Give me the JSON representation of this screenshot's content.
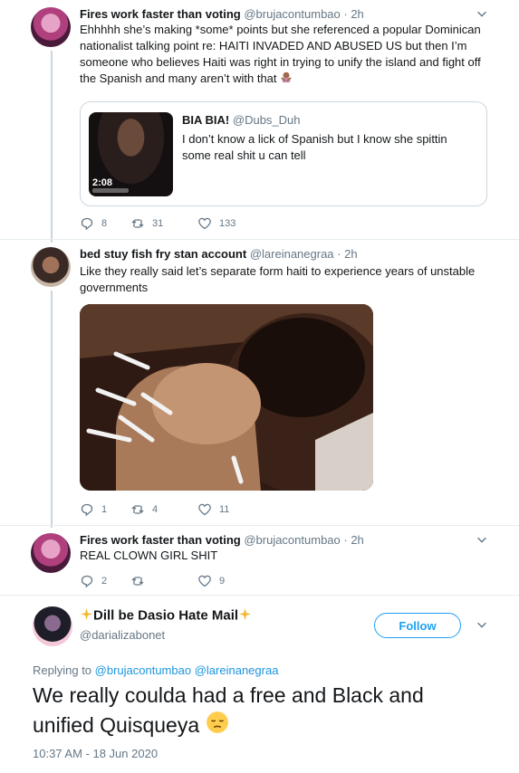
{
  "tweets": [
    {
      "name": "Fires work faster than voting",
      "handle": "@brujacontumbao",
      "sep": " · ",
      "time": "2h",
      "text": "Ehhhhh she’s making *some* points but she referenced a popular Dominican nationalist talking point re: HAITI INVADED AND ABUSED US but then I’m someone who believes Haiti was right in trying to unify the island and fight off the Spanish and many aren’t with that",
      "emoji": "person-gesturing-no",
      "quote": {
        "name": "BIA BIA!",
        "handle": "@Dubs_Duh",
        "text": "I don’t know a lick of Spanish but I know she spittin some real shit u can tell",
        "duration": "2:08"
      },
      "replies": "8",
      "retweets": "31",
      "likes": "133"
    },
    {
      "name": "bed stuy fish fry stan account",
      "handle": "@lareinanegraa",
      "sep": " · ",
      "time": "2h",
      "text": "Like they really said let’s separate form haiti to experience years of unstable governments",
      "replies": "1",
      "retweets": "4",
      "likes": "11"
    },
    {
      "name": "Fires work faster than voting",
      "handle": "@brujacontumbao",
      "sep": " · ",
      "time": "2h",
      "text": "REAL CLOWN GIRL SHIT",
      "replies": "2",
      "retweets": "",
      "likes": "9"
    }
  ],
  "main": {
    "name_prefix_emoji": "sparkles",
    "name": "Dill be Dasio Hate Mail",
    "name_suffix_emoji": "sparkles",
    "handle": "@darializabonet",
    "follow_label": "Follow",
    "replying_label": "Replying to ",
    "replying_to": [
      "@brujacontumbao",
      "@lareinanegraa"
    ],
    "text": "We really coulda had a free and Black and unified Quisqueya",
    "emoji": "pensive-face",
    "timestamp": "10:37 AM - 18 Jun 2020"
  },
  "colors": {
    "accent": "#1da1f2",
    "muted": "#657786",
    "border": "#ccd6dd"
  }
}
